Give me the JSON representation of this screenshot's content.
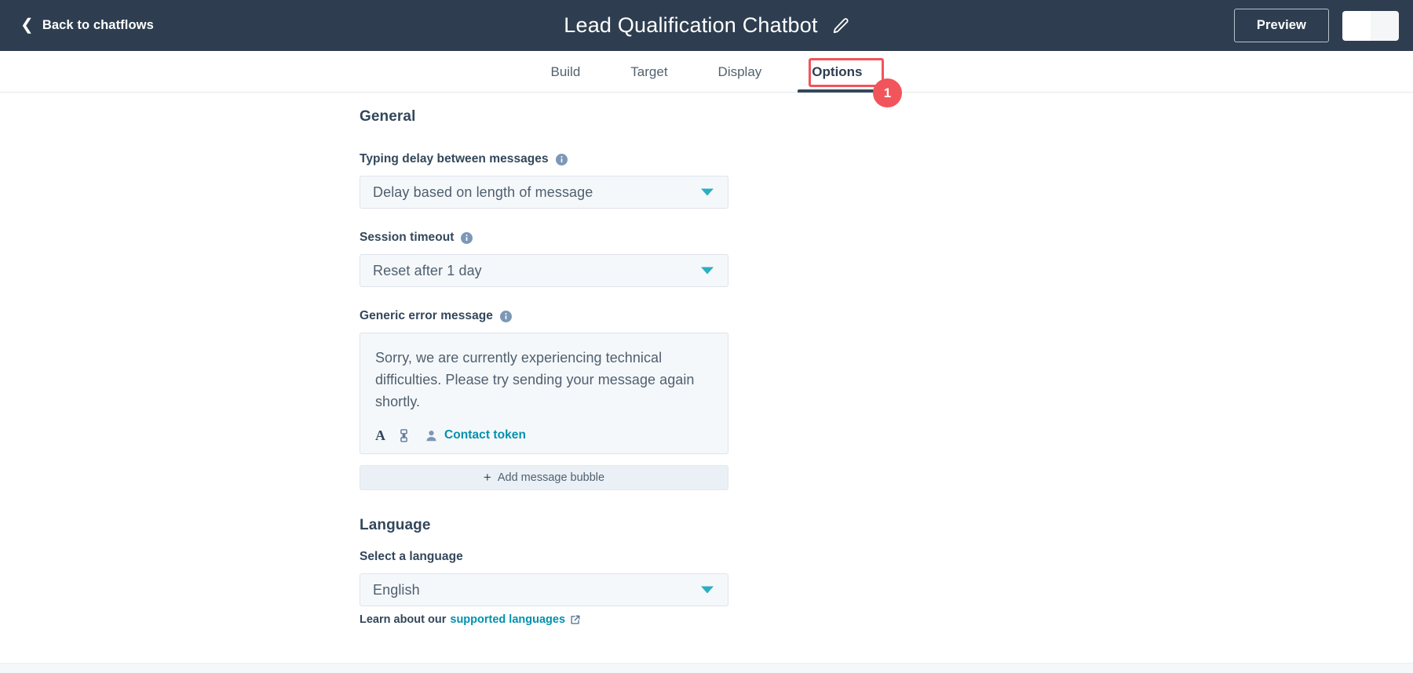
{
  "header": {
    "back_label": "Back to chatflows",
    "back_icon": "chevron-left-icon",
    "title": "Lead Qualification Chatbot",
    "edit_icon": "pencil-icon",
    "preview_label": "Preview",
    "blank_button_left_label": "",
    "blank_button_right_label": ""
  },
  "tabs": [
    {
      "label": "Build",
      "active": false
    },
    {
      "label": "Target",
      "active": false
    },
    {
      "label": "Display",
      "active": false
    },
    {
      "label": "Options",
      "active": true
    }
  ],
  "annotation": {
    "step_number": "1",
    "target": "Options",
    "color": "#f2545b"
  },
  "general": {
    "section_title": "General",
    "typing_delay": {
      "label": "Typing delay between messages",
      "info_icon": "info-icon",
      "value": "Delay based on length of message",
      "caret_icon": "chevron-down-icon"
    },
    "session_timeout": {
      "label": "Session timeout",
      "info_icon": "info-icon",
      "value": "Reset after 1 day",
      "caret_icon": "chevron-down-icon"
    },
    "generic_error": {
      "label": "Generic error message",
      "info_icon": "info-icon",
      "value": "Sorry, we are currently experiencing technical difficulties. Please try sending your message again shortly.",
      "toolbar": {
        "format_text_label": "A",
        "format_text_icon": "text-format-icon",
        "insert_link_icon": "link-icon",
        "contact_token_icon": "person-icon",
        "contact_token_label": "Contact token"
      }
    },
    "add_bubble": {
      "icon": "plus-icon",
      "label": "Add message bubble"
    }
  },
  "language": {
    "section_title": "Language",
    "select_label": "Select a language",
    "value": "English",
    "caret_icon": "chevron-down-icon",
    "help_prefix": "Learn about our",
    "help_link": "supported languages",
    "help_link_icon": "external-link-icon"
  },
  "colors": {
    "header_bg": "#2e3e50",
    "accent_teal": "#0091ae",
    "caret_teal": "#29afc2",
    "annotation_red": "#f2545b",
    "field_bg": "#f5f8fa",
    "text_primary": "#33475b"
  }
}
